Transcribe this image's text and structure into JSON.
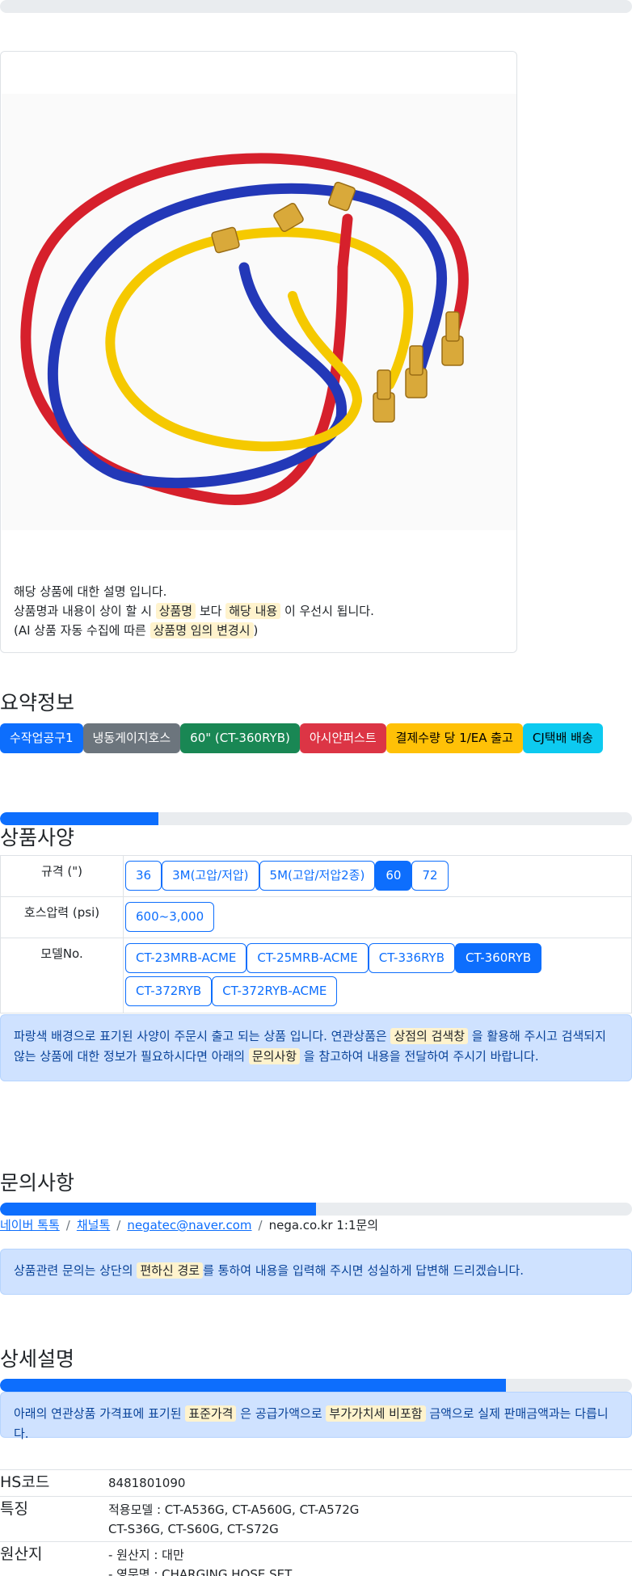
{
  "product": {
    "description": {
      "line1": "해당 상품에 대한 설명 입니다.",
      "line2_pre": "상품명과 내용이 상이 할 시 ",
      "line2_hl1": "상품명",
      "line2_mid": " 보다 ",
      "line2_hl2": "해당 내용",
      "line2_post": " 이 우선시 됩니다.",
      "line3_pre": "(AI 상품 자동 수집에 따른 ",
      "line3_hl": "상품명 임의 변경시",
      "line3_post": ")"
    }
  },
  "summary": {
    "title": "요약정보",
    "tags": [
      {
        "label": "수작업공구1",
        "color": "blue"
      },
      {
        "label": "냉동게이지호스",
        "color": "gray"
      },
      {
        "label": "60\" (CT-360RYB)",
        "color": "green"
      },
      {
        "label": "아시안퍼스트",
        "color": "red"
      },
      {
        "label": "결제수량 당 1/EA 출고",
        "color": "yellow"
      },
      {
        "label": "CJ택배 배송",
        "color": "cyan"
      }
    ],
    "progress": 0.25
  },
  "specs": {
    "title": "상품사양",
    "rows": [
      {
        "label": "규격 (\")",
        "options": [
          {
            "text": "36",
            "active": false
          },
          {
            "text": "3M(고압/저압)",
            "active": false
          },
          {
            "text": "5M(고압/저압2종)",
            "active": false
          },
          {
            "text": "60",
            "active": true
          },
          {
            "text": "72",
            "active": false
          }
        ]
      },
      {
        "label": "호스압력 (psi)",
        "options": [
          {
            "text": "600~3,000",
            "active": false
          }
        ]
      },
      {
        "label": "모델No.",
        "options": [
          {
            "text": "CT-23MRB-ACME",
            "active": false
          },
          {
            "text": "CT-25MRB-ACME",
            "active": false
          },
          {
            "text": "CT-336RYB",
            "active": false
          },
          {
            "text": "CT-360RYB",
            "active": true
          },
          {
            "text": "CT-372RYB",
            "active": false
          },
          {
            "text": "CT-372RYB-ACME",
            "active": false
          }
        ]
      }
    ],
    "notice": {
      "pre": "파랑색 배경으로 표기된 사양이 주문시 출고 되는 상품 입니다. 연관상품은 ",
      "hl1": "상점의 검색창",
      "mid": " 을 활용해 주시고 검색되지 않는 상품에 대한 정보가 필요하시다면 아래의 ",
      "hl2": "문의사항",
      "post": " 을 참고하여 내용을 전달하여 주시기 바랍니다."
    }
  },
  "inquiry": {
    "title": "문의사항",
    "progress": 0.5,
    "links": {
      "naver_talk": "네이버 톡톡",
      "channel_talk": "채널톡",
      "email": "negatec@naver.com",
      "site": "nega.co.kr 1:1문의"
    },
    "notice": {
      "pre": "상품관련 문의는 상단의 ",
      "hl": "편하신 경로",
      "post": "를 통하여 내용을 입력해 주시면 성실하게 답변해 드리겠습니다."
    }
  },
  "detail": {
    "title": "상세설명",
    "progress": 0.8,
    "notice": {
      "pre": "아래의 연관상품 가격표에 표기된 ",
      "hl1": "표준가격",
      "mid": " 은 공급가액으로 ",
      "hl2": "부가가치세 비포함",
      "post": " 금액으로 실제 판매금액과는 다릅니다."
    },
    "rows": [
      {
        "key": "HS코드",
        "lines": [
          "8481801090"
        ]
      },
      {
        "key": "특징",
        "lines": [
          "적용모델 : CT-A536G, CT-A560G, CT-A572G",
          "CT-S36G, CT-S60G, CT-S72G"
        ]
      },
      {
        "key": "원산지",
        "lines": [
          "- 원산지 : 대만",
          "- 영문명 : CHARGING HOSE SET"
        ]
      }
    ]
  }
}
